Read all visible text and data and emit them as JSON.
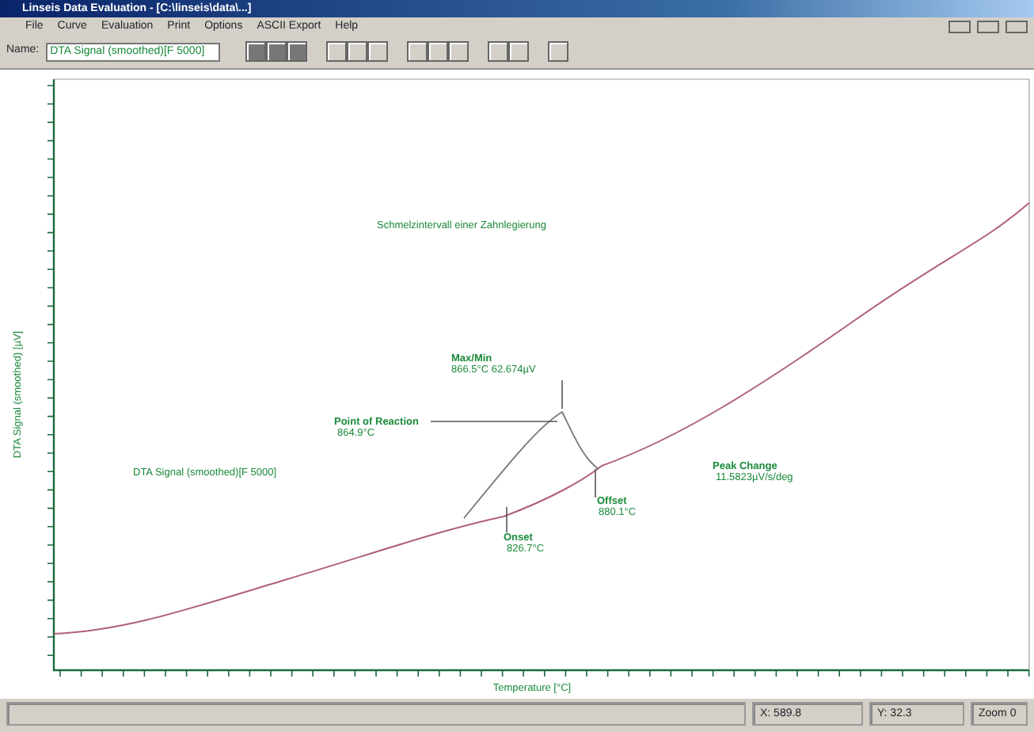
{
  "window": {
    "title": "Linseis Data Evaluation - [C:\\linseis\\data\\...]"
  },
  "menu": [
    "File",
    "Curve",
    "Evaluation",
    "Print",
    "Options",
    "ASCII Export",
    "Help"
  ],
  "toolbar": {
    "name_label": "Name:",
    "curve_select": "DTA Signal (smoothed)[F 5000]"
  },
  "chart": {
    "title": "Schmelzintervall einer Zahnlegierung",
    "ylabel": "DTA Signal (smoothed) [µV]",
    "xlabel": "Temperature [°C]",
    "annotations": [
      {
        "kind": "label",
        "text": "Max/Min"
      },
      {
        "kind": "value",
        "text": "866.5°C  62.674µV"
      },
      {
        "kind": "label",
        "text": "Point of Reaction"
      },
      {
        "kind": "value",
        "text": "864.9°C"
      },
      {
        "kind": "value",
        "text": "DTA Signal (smoothed)[F 5000]"
      },
      {
        "kind": "label",
        "text": "Onset"
      },
      {
        "kind": "value",
        "text": "826.7°C"
      },
      {
        "kind": "label",
        "text": "Offset"
      },
      {
        "kind": "value",
        "text": "880.1°C"
      },
      {
        "kind": "label",
        "text": "Peak Change"
      },
      {
        "kind": "value",
        "text": "11.5823µV/s/deg"
      }
    ]
  },
  "status_bar": [
    "X: 589.8",
    "Y: 32.3",
    "Zoom 0"
  ]
}
